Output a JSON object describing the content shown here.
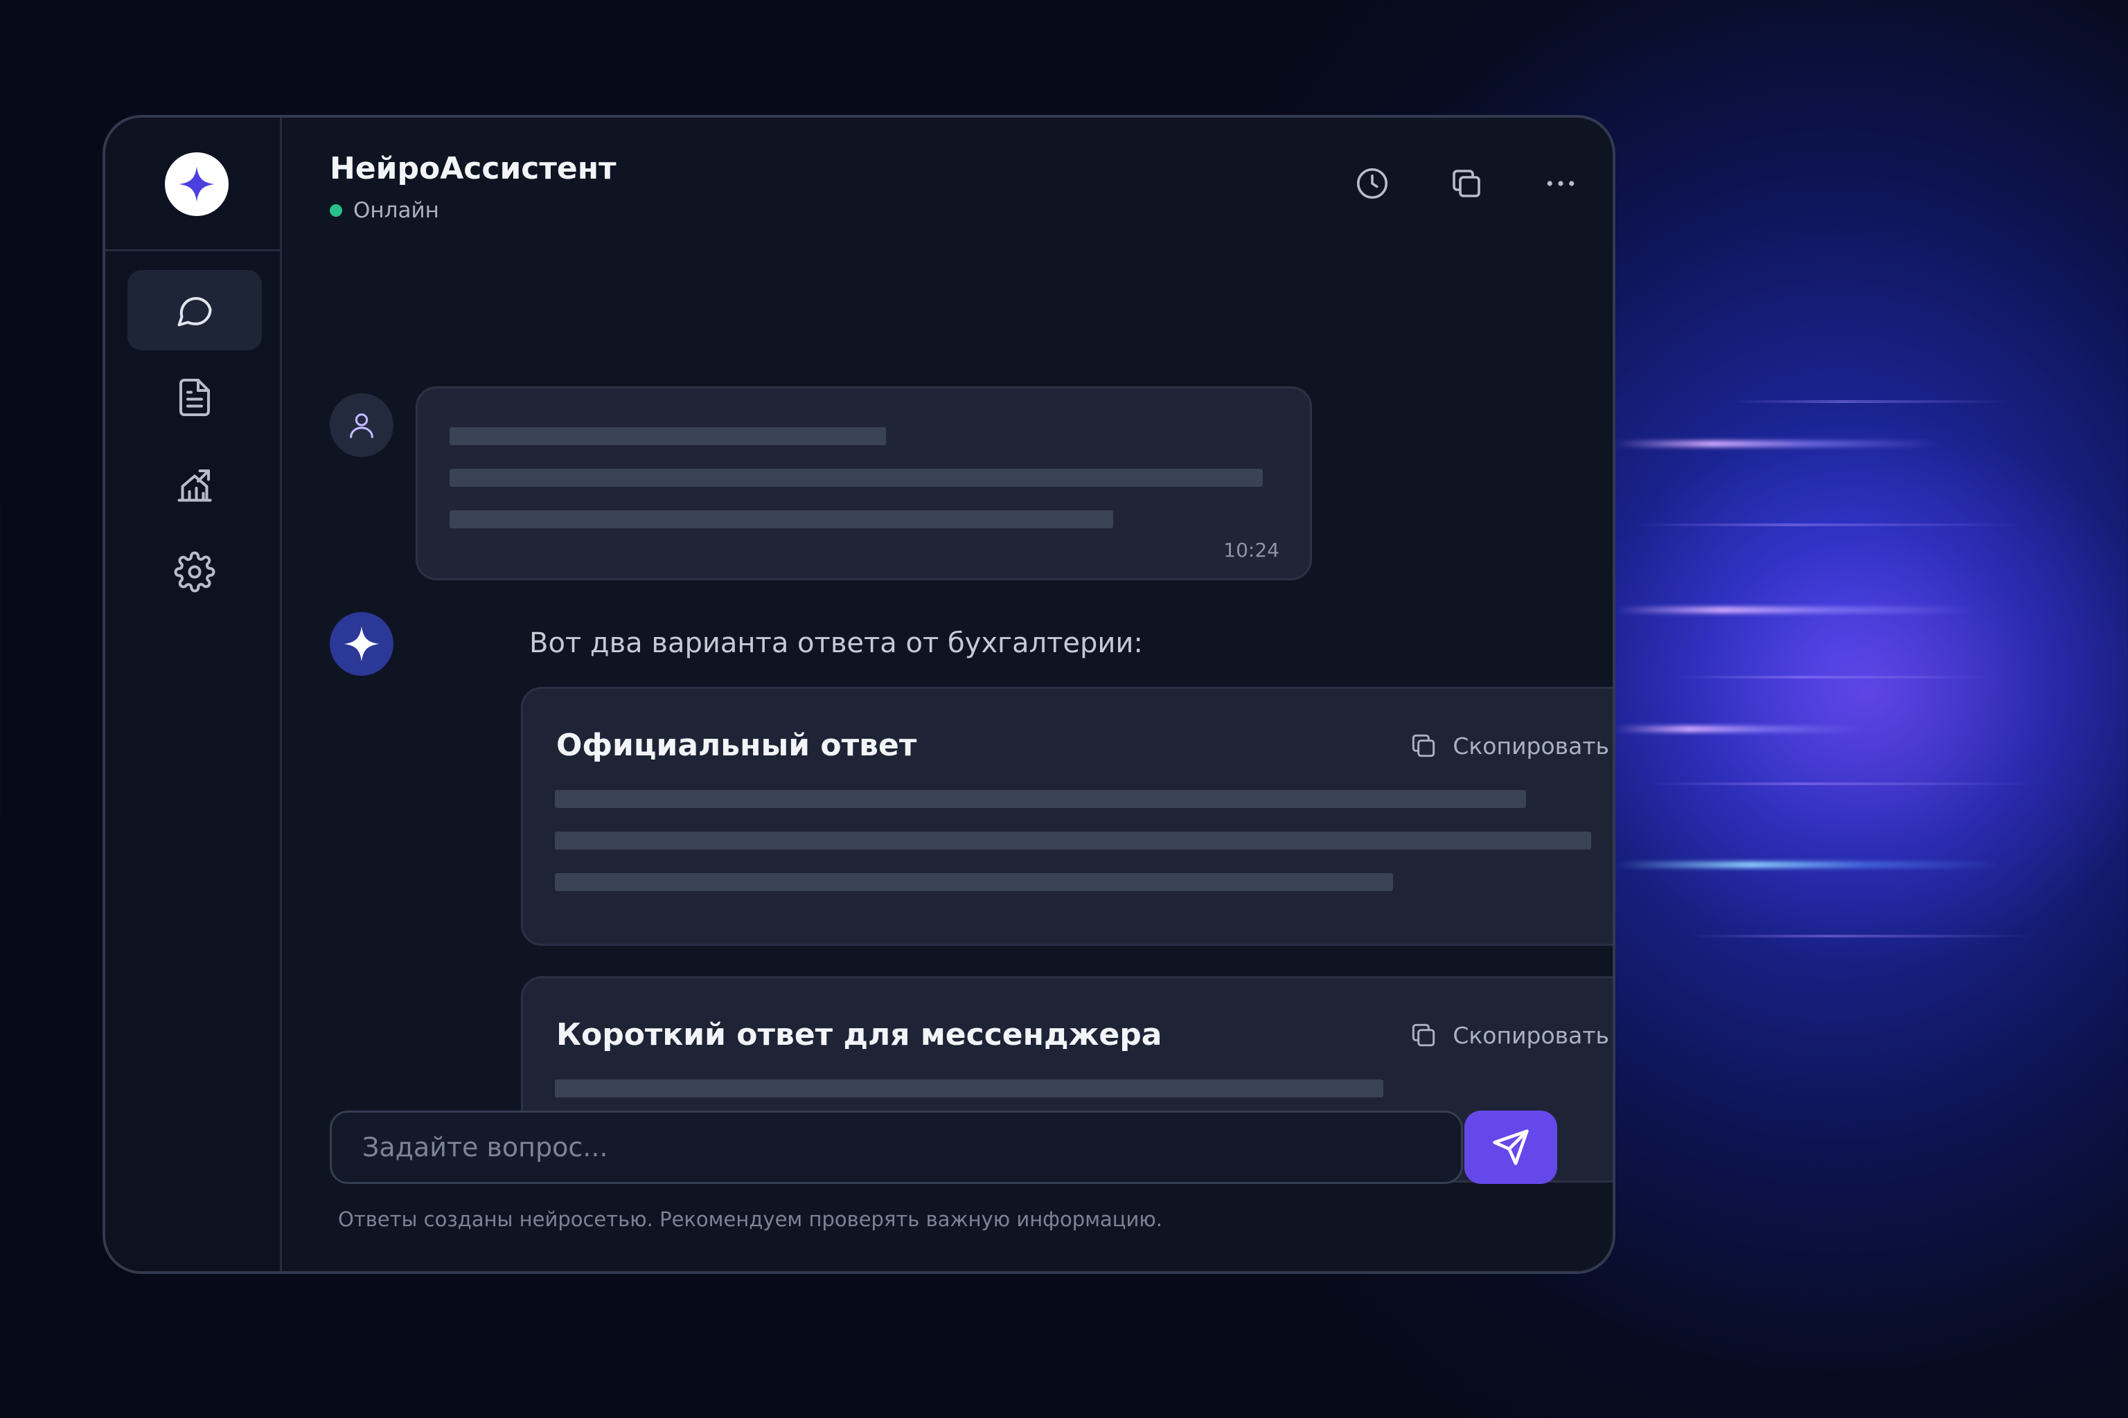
{
  "header": {
    "title": "НейроАссистент",
    "status": "Онлайн",
    "actions": [
      "history-icon",
      "copy-icon",
      "more-icon"
    ]
  },
  "sidebar": {
    "items": [
      {
        "icon": "chat-icon",
        "active": true
      },
      {
        "icon": "document-icon",
        "active": false
      },
      {
        "icon": "analytics-icon",
        "active": false
      },
      {
        "icon": "settings-icon",
        "active": false
      }
    ]
  },
  "chat": {
    "user_message": {
      "time": "10:24"
    },
    "bot_message": {
      "text": "Вот два варианта ответа от бухгалтерии:",
      "cards": [
        {
          "title": "Официальный ответ",
          "copy_label": "Скопировать"
        },
        {
          "title": "Короткий ответ для мессенджера",
          "copy_label": "Скопировать"
        }
      ]
    }
  },
  "composer": {
    "placeholder": "Задайте вопрос...",
    "disclaimer": "Ответы созданы нейросетью. Рекомендуем проверять важную информацию."
  },
  "colors": {
    "accent": "#6548ea",
    "online": "#27c18f",
    "background": "#0f1422"
  }
}
